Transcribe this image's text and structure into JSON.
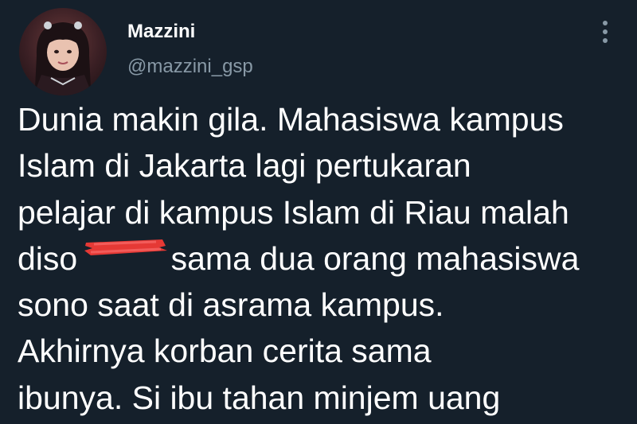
{
  "tweet": {
    "display_name": "Mazzini",
    "handle": "@mazzini_gsp",
    "text_lines": [
      "Dunia makin gila. Mahasiswa kampus",
      "Islam di Jakarta lagi pertukaran",
      "pelajar di kampus Islam di Riau malah",
      "diso",
      "sama dua orang mahasiswa",
      "sono saat di asrama kampus.",
      "Akhirnya korban cerita sama",
      "ibunya. Si ibu tahan minjem uang"
    ]
  },
  "icons": {
    "more": "more-options-icon",
    "avatar": "profile-avatar"
  },
  "colors": {
    "background": "#15202b",
    "primary_text": "#ffffff",
    "secondary_text": "#8899a6",
    "redaction": "#e53935"
  }
}
